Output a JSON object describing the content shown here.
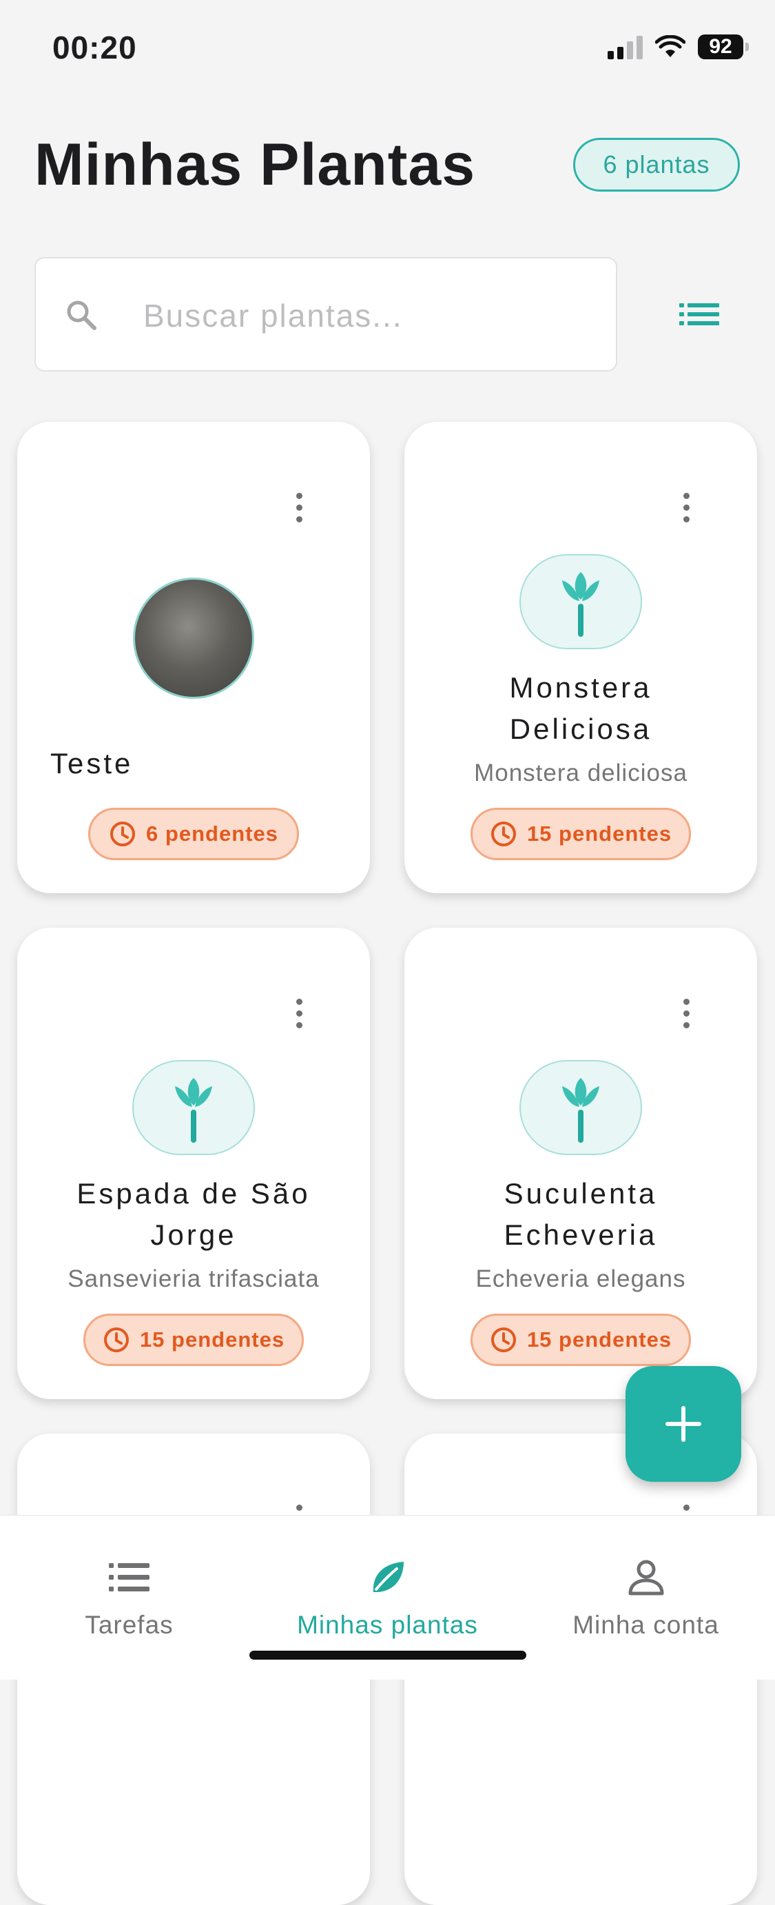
{
  "status_bar": {
    "time": "00:20",
    "battery": "92"
  },
  "header": {
    "title": "Minhas Plantas",
    "count_badge": "6 plantas"
  },
  "search": {
    "placeholder": "Buscar plantas...",
    "value": ""
  },
  "plants": [
    {
      "name": "Teste",
      "scientific": "",
      "pending": "6 pendentes",
      "has_photo": true
    },
    {
      "name_line1": "Monstera",
      "name_line2": "Deliciosa",
      "scientific": "Monstera deliciosa",
      "pending": "15 pendentes"
    },
    {
      "name_line1": "Espada de São",
      "name_line2": "Jorge",
      "scientific": "Sansevieria trifasciata",
      "pending": "15 pendentes"
    },
    {
      "name_line1": "Suculenta",
      "name_line2": "Echeveria",
      "scientific": "Echeveria elegans",
      "pending": "15 pendentes"
    }
  ],
  "bottom_nav": [
    {
      "label": "Tarefas",
      "icon": "list-icon",
      "active": false
    },
    {
      "label": "Minhas plantas",
      "icon": "leaf-icon",
      "active": true
    },
    {
      "label": "Minha conta",
      "icon": "person-icon",
      "active": false
    }
  ],
  "colors": {
    "accent": "#22b2a6",
    "pending_text": "#e2591f",
    "pending_bg": "#fcdccc",
    "background": "#f4f4f5"
  }
}
